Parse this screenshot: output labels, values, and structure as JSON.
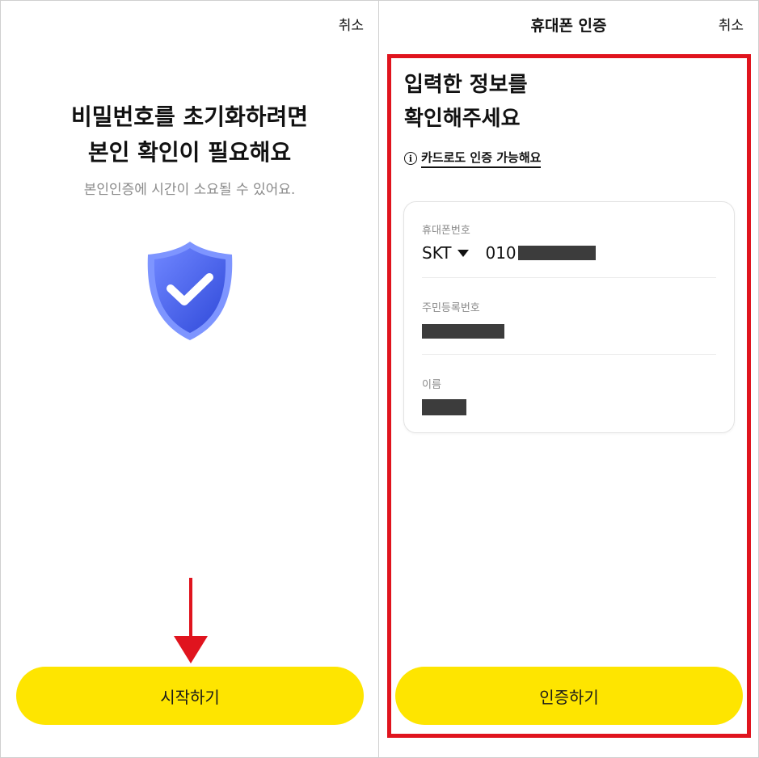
{
  "left_screen": {
    "cancel_label": "취소",
    "title_line1": "비밀번호를 초기화하려면",
    "title_line2": "본인 확인이 필요해요",
    "subtitle": "본인인증에 시간이 소요될 수 있어요.",
    "start_button_label": "시작하기",
    "shield_icon": "shield-check-icon",
    "shield_color": "#4a63e8"
  },
  "right_screen": {
    "header_title": "휴대폰 인증",
    "cancel_label": "취소",
    "title_line1": "입력한 정보를",
    "title_line2": "확인해주세요",
    "card_link_label": "카드로도 인증 가능해요",
    "phone": {
      "label": "휴대폰번호",
      "carrier": "SKT",
      "prefix": "010"
    },
    "jumin": {
      "label": "주민등록번호"
    },
    "name": {
      "label": "이름"
    },
    "verify_button_label": "인증하기"
  },
  "colors": {
    "button_yellow": "#fee500",
    "highlight_red": "#e0141e"
  }
}
